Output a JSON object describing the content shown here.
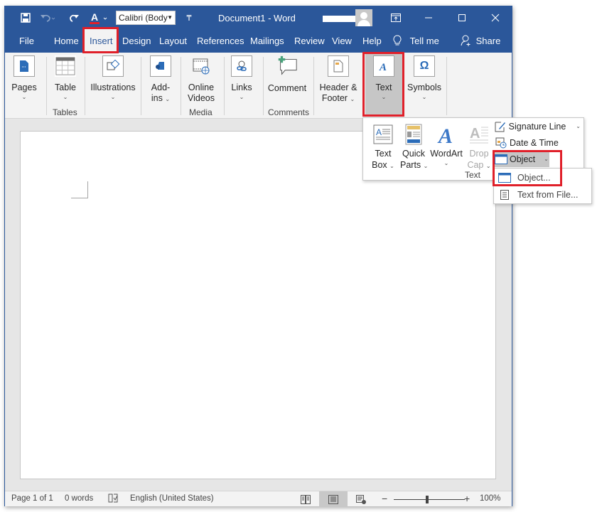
{
  "window": {
    "doc_title": "Document1  -  Word",
    "font_name": "Calibri (Body",
    "qat": [
      "save-icon",
      "undo-icon",
      "redo-icon",
      "font-color-icon",
      "customize-qat-icon"
    ],
    "controls": [
      "ribbon-display-options-icon",
      "minimize-icon",
      "maximize-icon",
      "close-icon"
    ]
  },
  "tabs": [
    "File",
    "Home",
    "Insert",
    "Design",
    "Layout",
    "References",
    "Mailings",
    "Review",
    "View",
    "Help"
  ],
  "tell_me": "Tell me",
  "share": "Share",
  "ribbon": {
    "buttons": [
      {
        "label": "Pages",
        "icon": "pages-icon"
      },
      {
        "label": "Table",
        "icon": "table-icon"
      },
      {
        "label": "Illustrations",
        "icon": "illustrations-icon"
      },
      {
        "label": "Add-",
        "label2": "ins",
        "icon": "add-ins-icon"
      },
      {
        "label": "Online",
        "label2": "Videos",
        "icon": "online-videos-icon"
      },
      {
        "label": "Links",
        "icon": "links-icon"
      },
      {
        "label": "Comment",
        "icon": "comment-icon"
      },
      {
        "label": "Header &",
        "label2": "Footer",
        "icon": "header-footer-icon"
      },
      {
        "label": "Text",
        "icon": "text-icon"
      },
      {
        "label": "Symbols",
        "icon": "symbols-icon"
      }
    ],
    "groups": [
      "Tables",
      "Media",
      "Comments"
    ]
  },
  "text_panel": {
    "buttons": [
      {
        "label": "Text",
        "label2": "Box",
        "enabled": true
      },
      {
        "label": "Quick",
        "label2": "Parts",
        "enabled": true
      },
      {
        "label": "WordArt",
        "label2": "",
        "enabled": true
      },
      {
        "label": "Drop",
        "label2": "Cap",
        "enabled": false
      }
    ],
    "small": [
      "Signature Line",
      "Date & Time",
      "Object"
    ],
    "group_label": "Text"
  },
  "object_menu": [
    "Object...",
    "Text from File..."
  ],
  "status": {
    "page": "Page 1 of 1",
    "words": "0 words",
    "language": "English (United States)",
    "zoom": "100%",
    "zoom_percent": 100
  }
}
